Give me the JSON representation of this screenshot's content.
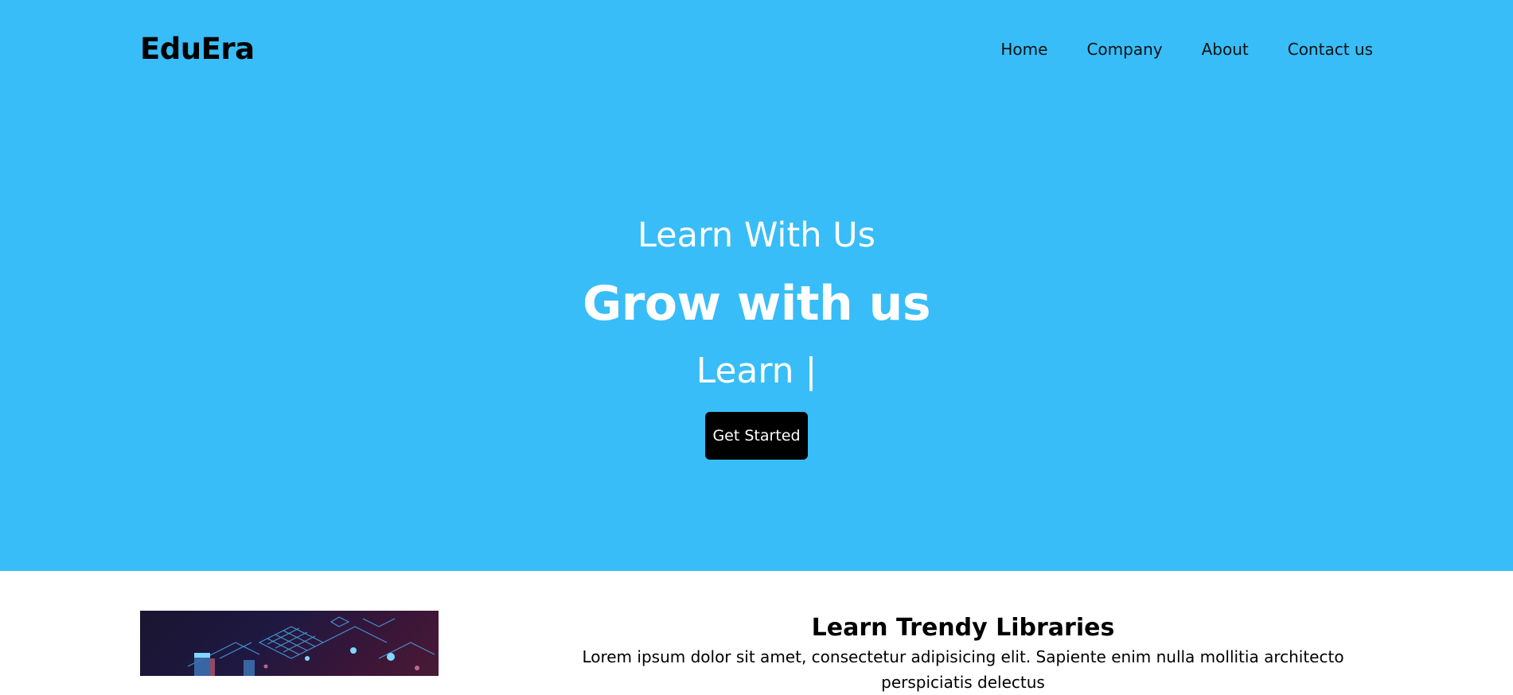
{
  "header": {
    "brand": "EduEra",
    "nav": [
      "Home",
      "Company",
      "About",
      "Contact us"
    ]
  },
  "hero": {
    "subtitle": "Learn With Us",
    "title": "Grow with us",
    "typed_text": "Learn |",
    "cta_label": "Get Started",
    "background_color": "#38bdf8"
  },
  "feature": {
    "image_icon": "isometric-tech-illustration",
    "title": "Learn Trendy Libraries",
    "body_lines": [
      "Lorem ipsum dolor sit amet, consectetur adipisicing elit. Sapiente enim nulla mollitia architecto perspiciatis delectus"
    ]
  },
  "colors": {
    "accent": "#38bdf8",
    "button": "#000000",
    "hero_text": "#ffffff"
  }
}
